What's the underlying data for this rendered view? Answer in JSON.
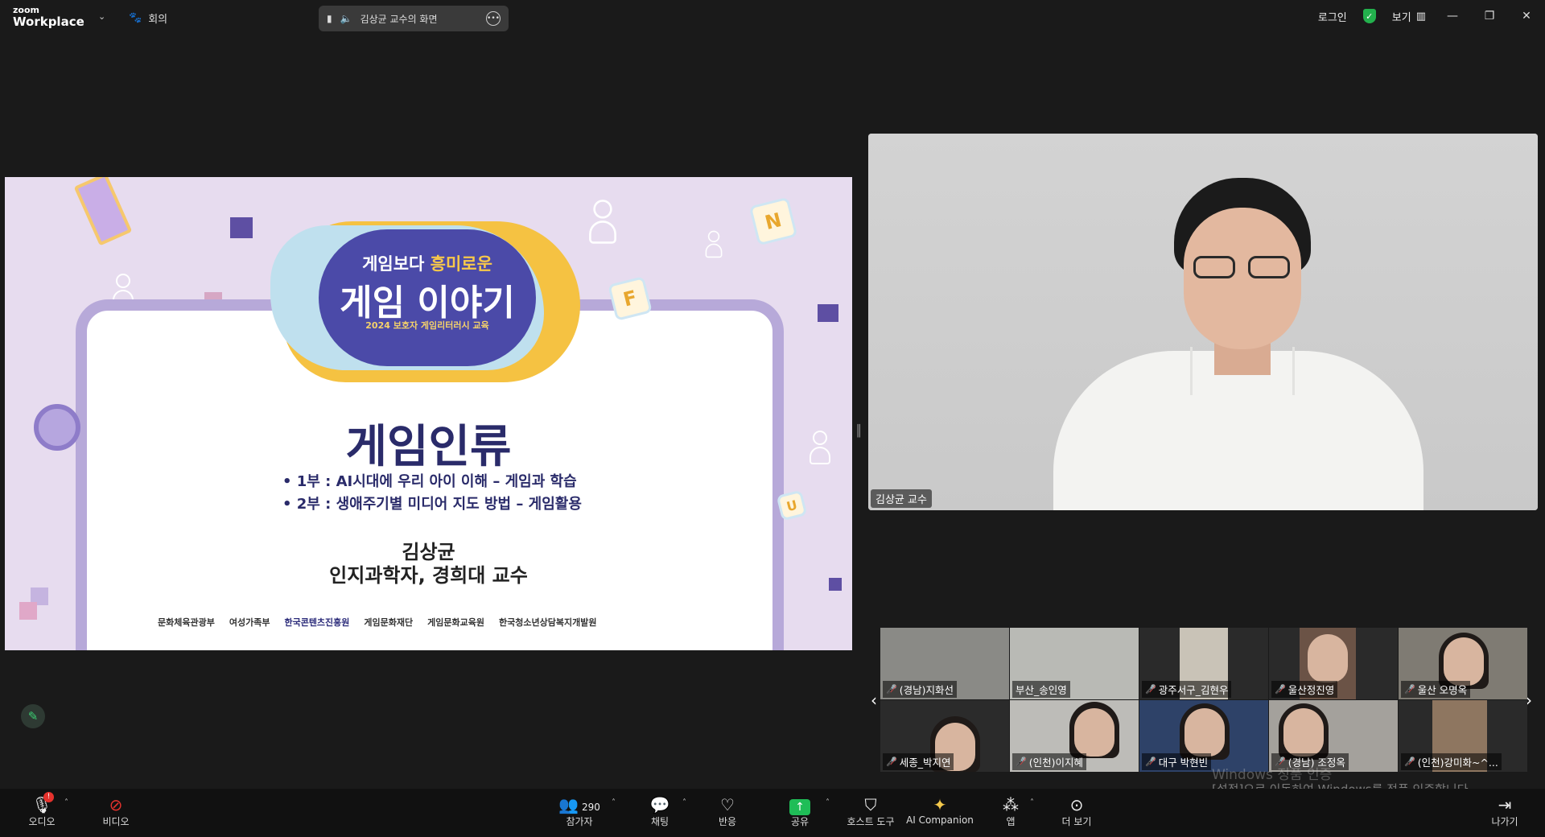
{
  "topbar": {
    "logo_line1": "zoom",
    "logo_line2": "Workplace",
    "meeting_menu_label": "회의",
    "share_pill_text": "김상균 교수의 화면",
    "login_label": "로그인",
    "view_label": "보기",
    "window_controls": [
      "—",
      "❐",
      "✕"
    ]
  },
  "slide": {
    "subtitle_prefix": "게임보다 ",
    "subtitle_highlight": "흥미로운",
    "main_title": "게임 이야기",
    "small_caption": "2024 보호자 게임리터러시 교육",
    "heading": "게임인류",
    "bullets": [
      "• 1부 : AI시대에 우리 아이 이해 – 게임과 학습",
      "• 2부 : 생애주기별 미디어 지도 방법 – 게임활용"
    ],
    "presenter_name": "김상균",
    "presenter_title": "인지과학자, 경희대 교수",
    "logos": [
      "문화체육관광부",
      "여성가족부",
      "한국콘텐츠진흥원",
      "게임문화재단",
      "게임문화교육원",
      "한국청소년상담복지개발원"
    ],
    "tile_letters": [
      "N",
      "F",
      "U"
    ]
  },
  "speaker": {
    "name": "김상균 교수"
  },
  "gallery": {
    "participants": [
      {
        "name": "(경남)지화선",
        "muted": true
      },
      {
        "name": "부산_송인영",
        "muted": false
      },
      {
        "name": "광주서구_김현우",
        "muted": true
      },
      {
        "name": "울산정진영",
        "muted": true
      },
      {
        "name": "울산 오명옥",
        "muted": true
      },
      {
        "name": "세종_박지연",
        "muted": true
      },
      {
        "name": "(인천)이지혜",
        "muted": true
      },
      {
        "name": "대구 박현빈",
        "muted": true
      },
      {
        "name": "(경남) 조정옥",
        "muted": true
      },
      {
        "name": "(인천)강미화~^...",
        "muted": true
      }
    ]
  },
  "watermark": {
    "line1": "Windows 정품 인증",
    "line2": "[설정]으로 이동하여 Windows를 정품 인증합니다."
  },
  "toolbar": {
    "audio": "오디오",
    "audio_badge": "!",
    "video": "비디오",
    "participants": "참가자",
    "participants_count": "290",
    "chat": "채팅",
    "reactions": "반응",
    "share": "공유",
    "host_tools": "호스트 도구",
    "ai_companion": "AI Companion",
    "apps": "앱",
    "more": "더 보기",
    "leave": "나가기"
  },
  "colors": {
    "background": "#1a1a1a",
    "accent_green": "#1fbd57",
    "alert_red": "#e5322d",
    "slide_navy": "#2a2b6a",
    "slide_purple": "#4b4aa8"
  }
}
